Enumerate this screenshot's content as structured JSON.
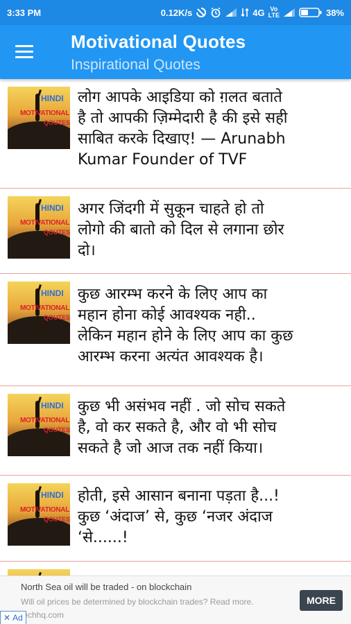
{
  "status_bar": {
    "time": "3:33 PM",
    "speed": "0.12K/s",
    "network": "4G",
    "volte_top": "Vo",
    "volte_bottom": "LTE",
    "battery": "38%"
  },
  "app_bar": {
    "title": "Motivational Quotes",
    "subtitle": "Inspirational Quotes"
  },
  "thumbnail": {
    "line1": "HINDI",
    "line2": "MOTIVATIONAL",
    "line3": "QOUTES"
  },
  "quotes": [
    {
      "lines": [
        "लोग आपके आइडिया को ग़लत बताते",
        "है तो आपकी ज़िम्मेदारी है की इसे सही",
        "साबित करके दिखाए! — Arunabh",
        "Kumar Founder of TVF"
      ]
    },
    {
      "lines": [
        "अगर जिंदगी में सुकून चाहते हो तो",
        "लोगो की बातो को दिल से लगाना छोर",
        "दो।"
      ]
    },
    {
      "lines": [
        "कुछ आरम्भ करने के लिए आप का",
        "महान होना कोई आवश्यक नही..",
        "लेकिन महान होने के लिए आप का कुछ",
        "आरम्भ करना अत्यंत आवश्यक है।"
      ]
    },
    {
      "lines": [
        "कुछ भी असंभव नहीं . जो सोच सकते",
        "है, वो कर सकते है, और वो भी सोच",
        "सकते है जो आज तक नहीं किया।"
      ]
    },
    {
      "lines": [
        "होती, इसे आसान बनाना पड़ता है...!",
        "कुछ ‘अंदाज’ से, कुछ ‘नजर अंदाज",
        "‘से......!"
      ]
    }
  ],
  "ad": {
    "title": "North Sea oil will be traded - on blockchain",
    "body": "Will oil prices be determined by blockchain trades? Read more. techhq.com",
    "cta": "MORE",
    "choices": "Ad",
    "close": "✕"
  }
}
